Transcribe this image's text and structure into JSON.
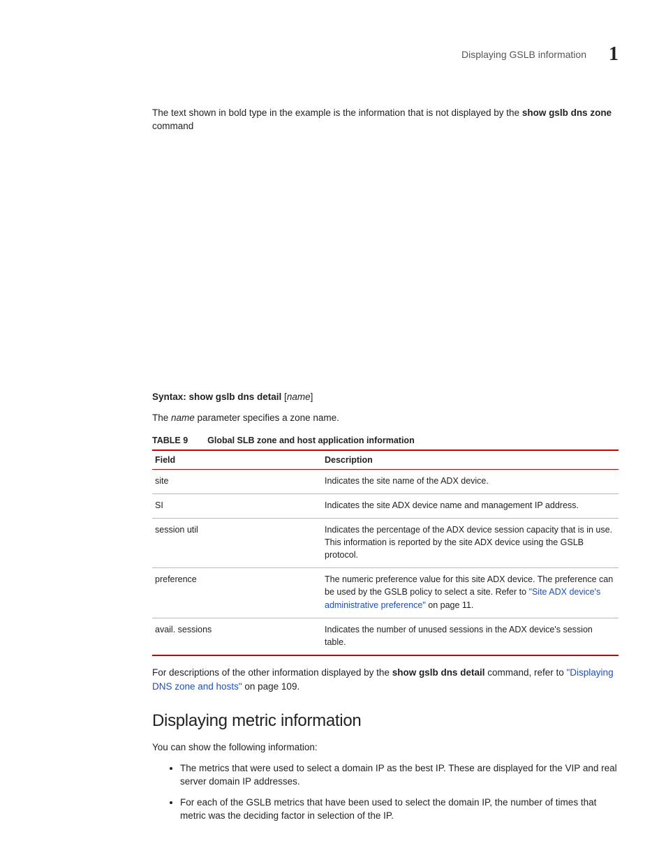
{
  "header": {
    "title": "Displaying GSLB information",
    "chapter": "1"
  },
  "intro": {
    "pre": "The text shown in bold type in the example is the information that is not displayed by the ",
    "bold1": "show gslb dns zone",
    "post": " command"
  },
  "syntax": {
    "label": "Syntax:  ",
    "cmd": "show gslb dns detail",
    "bracket_open": " [",
    "arg": "name",
    "bracket_close": "]",
    "desc_pre": "The ",
    "desc_arg": "name",
    "desc_post": " parameter specifies a zone name."
  },
  "table": {
    "caption_num": "TABLE 9",
    "caption_title": "Global SLB zone and host application information",
    "headers": {
      "field": "Field",
      "desc": "Description"
    },
    "rows": [
      {
        "field": "site",
        "desc": "Indicates the site name of the ADX device."
      },
      {
        "field": "SI",
        "desc": "Indicates the site ADX device name and management IP address."
      },
      {
        "field": "session util",
        "desc": "Indicates the percentage of the ADX device session capacity that is in use. This information is reported by the site ADX device using the GSLB protocol."
      },
      {
        "field": "preference",
        "desc_pre": "The numeric preference value for this site ADX device. The preference can be used by the GSLB policy to select a site. Refer to ",
        "desc_link": "\"Site ADX device's administrative preference\"",
        "desc_post": " on page 11."
      },
      {
        "field": "avail. sessions",
        "desc": "Indicates the number of unused sessions in the ADX device's session table."
      }
    ]
  },
  "after_table": {
    "pre": "For descriptions of the other information displayed by the ",
    "bold": "show gslb dns detail",
    "mid": " command, refer to ",
    "link": "\"Displaying DNS zone and hosts\"",
    "post": " on page 109."
  },
  "section": {
    "heading": "Displaying metric information",
    "intro": "You can show the following information:",
    "bullets": [
      "The metrics that were used to select a domain IP as the best IP. These are displayed for the VIP and real server domain IP addresses.",
      "For each of the GSLB metrics that have been used to select the domain IP, the number of times that metric was the deciding factor in selection of the IP."
    ]
  }
}
